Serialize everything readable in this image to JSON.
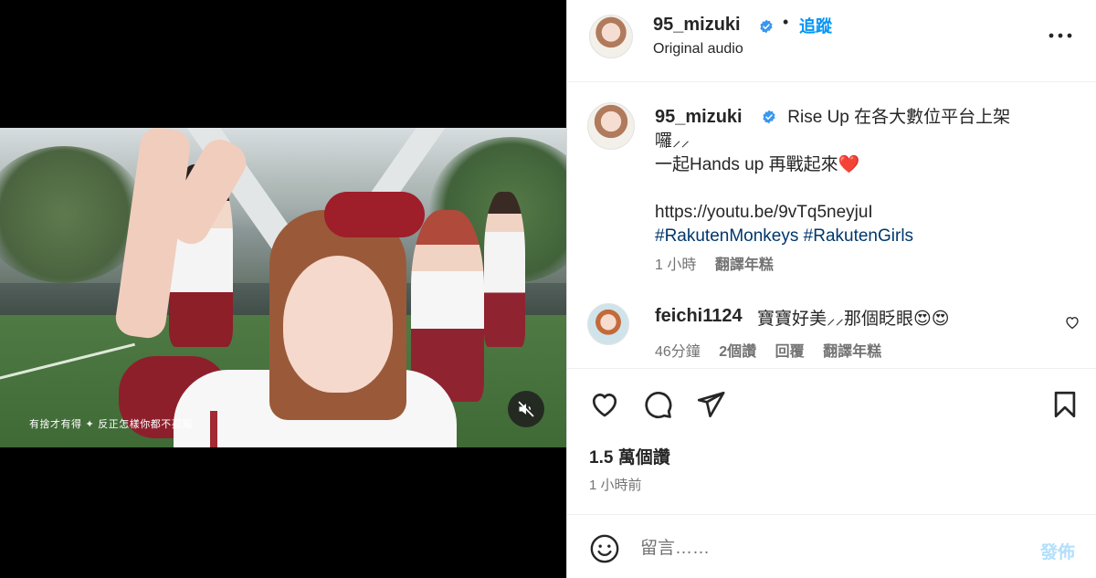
{
  "media": {
    "video_caption": "有捨才有得 ✦ 反正怎樣你都不孤獨",
    "mute_icon": "speaker-muted-icon"
  },
  "header": {
    "username": "95_mizuki",
    "separator": "•",
    "follow_label": "追蹤",
    "audio": "Original audio",
    "more_icon": "more-horizontal-icon"
  },
  "caption": {
    "username": "95_mizuki",
    "line1": "Rise Up 在各大數位平台上架囉⸝⸝",
    "line2": "一起Hands up 再戰起來❤️",
    "link": "https://youtu.be/9vTq5neyjuI",
    "hashtag1": "#RakutenMonkeys",
    "hashtag2": "#RakutenGirls",
    "time": "1 小時",
    "translate": "翻譯年糕"
  },
  "comment": {
    "username": "feichi1124",
    "text": "寶寶好美⸝⸝那個眨眼😍😍",
    "time": "46分鐘",
    "likes": "2個讚",
    "reply": "回覆",
    "translate": "翻譯年糕"
  },
  "actions": {
    "likes_count": "1.5 萬個讚",
    "posted_ago": "1 小時前"
  },
  "composer": {
    "placeholder": "留言……",
    "post_label": "發佈"
  },
  "colors": {
    "accent": "#0095f6",
    "link": "#00376b",
    "muted": "#737373",
    "post_disabled": "#b2dffc",
    "verified": "#3897f0"
  }
}
